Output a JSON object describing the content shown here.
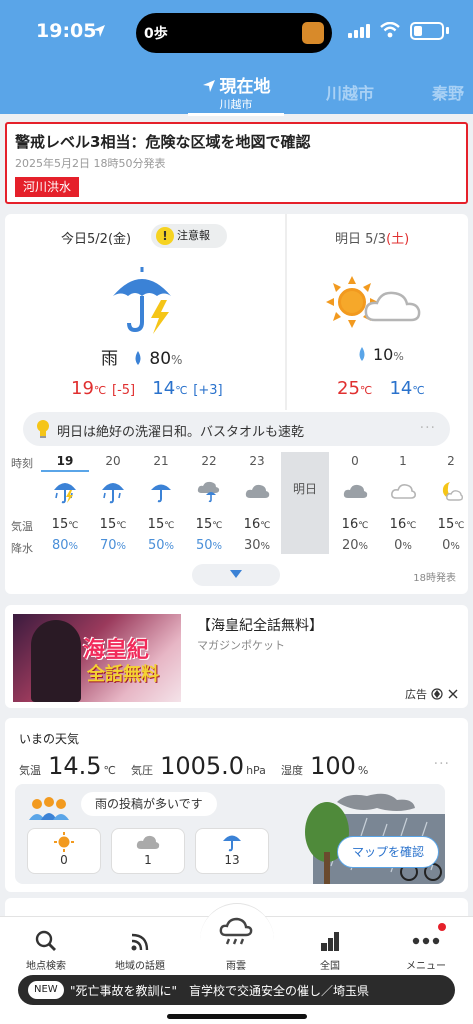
{
  "status_bar": {
    "time": "19:05",
    "steps": "0歩"
  },
  "location_tabs": [
    {
      "label": "現在地",
      "sub": "川越市"
    },
    {
      "label": "川越市"
    },
    {
      "label": "秦野"
    }
  ],
  "alert": {
    "title": "警戒レベル3相当：危険な区域を地図で確認",
    "date": "2025年5月2日 18時50分発表",
    "badge": "河川洪水"
  },
  "today": {
    "label": "今日",
    "date": "5/2",
    "weekday": "(金)",
    "advisory_icon": "!",
    "advisory": "注意報",
    "condition": "雨",
    "rain_pct": "80",
    "pct_unit": "%",
    "high": "19",
    "high_diff": "[-5]",
    "low": "14",
    "low_diff": "[+3]",
    "deg_unit": "℃"
  },
  "tomorrow": {
    "label": "明日",
    "date": "5/3",
    "weekday": "(土)",
    "rain_pct": "10",
    "pct_unit": "%",
    "high": "25",
    "low": "14",
    "deg_unit": "℃"
  },
  "tip": {
    "text": "明日は絶好の洗濯日和。バスタオルも速乾",
    "more": "···"
  },
  "hourly": {
    "row_labels": {
      "hour": "時刻",
      "temp": "気温",
      "rain": "降水"
    },
    "tomorrow_label": "明日",
    "hours": [
      {
        "hour": "19",
        "icon": "rain-thunder",
        "temp": "15",
        "rain": "80"
      },
      {
        "hour": "20",
        "icon": "rain",
        "temp": "15",
        "rain": "70"
      },
      {
        "hour": "21",
        "icon": "umbrella",
        "temp": "15",
        "rain": "50"
      },
      {
        "hour": "22",
        "icon": "cloud-umbrella",
        "temp": "15",
        "rain": "50"
      },
      {
        "hour": "23",
        "icon": "cloud",
        "temp": "16",
        "rain": "30"
      },
      {
        "hour": "0",
        "icon": "cloud",
        "temp": "16",
        "rain": "20"
      },
      {
        "hour": "1",
        "icon": "cloud-light",
        "temp": "16",
        "rain": "0"
      },
      {
        "hour": "2",
        "icon": "moon-cloud",
        "temp": "15",
        "rain": "0"
      }
    ],
    "deg_unit": "℃",
    "pct_unit": "%",
    "issued": "18時発表"
  },
  "ad": {
    "image_text_1": "海皇紀",
    "image_text_2": "全話無料",
    "title": "【海皇紀全話無料】",
    "sub": "マガジンポケット",
    "label": "広告"
  },
  "now": {
    "title": "いまの天気",
    "temp_label": "気温",
    "temp": "14.5",
    "temp_unit": "℃",
    "pressure_label": "気圧",
    "pressure": "1005.0",
    "pressure_unit": "hPa",
    "humidity_label": "湿度",
    "humidity": "100",
    "humidity_unit": "%",
    "more": "···",
    "posts_text": "雨の投稿が多いです",
    "counts": [
      {
        "icon": "sun-icon",
        "value": "0"
      },
      {
        "icon": "cloud-icon",
        "value": "1"
      },
      {
        "icon": "umbrella-icon",
        "value": "13"
      }
    ],
    "map_button": "マップを確認"
  },
  "bottom_nav": [
    {
      "label": "地点検索",
      "icon": "search-icon"
    },
    {
      "label": "地域の話題",
      "icon": "broadcast-icon"
    },
    {
      "label": "雨雲",
      "icon": "rain-cloud-icon"
    },
    {
      "label": "全国",
      "icon": "chart-icon"
    },
    {
      "label": "メニュー",
      "icon": "menu-dots-icon"
    }
  ],
  "ticker": {
    "badge": "NEW",
    "text": "\"死亡事故を教訓に\"　盲学校で交通安全の催し／埼玉県"
  },
  "colors": {
    "header": "#5aa5e8",
    "alert_red": "#e5202a",
    "high_temp": "#e03030",
    "low_temp": "#2a72cc",
    "umbrella_blue": "#3b82d6",
    "thunder_yellow": "#f5c518",
    "sun_orange": "#f29a1f"
  }
}
